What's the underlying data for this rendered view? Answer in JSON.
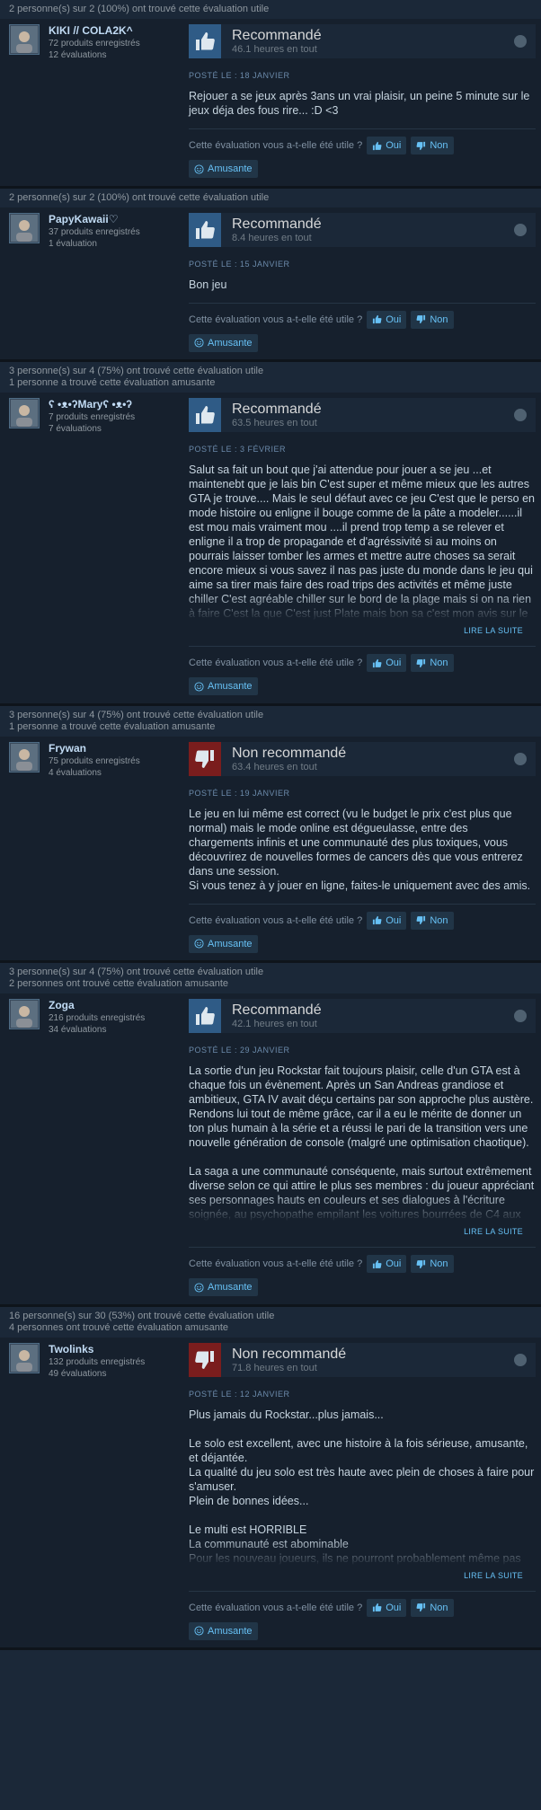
{
  "ui": {
    "helpful_question": "Cette évaluation vous a-t-elle été utile ?",
    "yes": "Oui",
    "no": "Non",
    "funny": "Amusante",
    "read_more": "LIRE LA SUITE"
  },
  "colors": {
    "recommended": "#2f5b86",
    "not_recommended": "#7a1d1d",
    "link": "#66c0f4"
  },
  "reviews": [
    {
      "helpful_line": "2 personne(s) sur 2 (100%) ont trouvé cette évaluation utile",
      "funny_line": "",
      "user": "KIKI // COLA2K^",
      "products": "72 produits enregistrés",
      "reviews_count": "12 évaluations",
      "recommended": true,
      "verdict": "Recommandé",
      "hours": "46.1 heures en tout",
      "posted": "POSTÉ LE : 18 JANVIER",
      "text": "Rejouer a se jeux après 3ans un vrai plaisir, un peine 5 minute sur le jeux déja des fous rire... :D <3",
      "read_more": false
    },
    {
      "helpful_line": "2 personne(s) sur 2 (100%) ont trouvé cette évaluation utile",
      "funny_line": "",
      "user": "PapyKawaii♡",
      "products": "37 produits enregistrés",
      "reviews_count": "1 évaluation",
      "recommended": true,
      "verdict": "Recommandé",
      "hours": "8.4 heures en tout",
      "posted": "POSTÉ LE : 15 JANVIER",
      "text": "Bon jeu",
      "read_more": false
    },
    {
      "helpful_line": "3 personne(s) sur 4 (75%) ont trouvé cette évaluation utile",
      "funny_line": "1 personne a trouvé cette évaluation amusante",
      "user": "ʕ •ᴥ•ʔMaryʕ •ᴥ•ʔ",
      "products": "7 produits enregistrés",
      "reviews_count": "7 évaluations",
      "recommended": true,
      "verdict": "Recommandé",
      "hours": "63.5 heures en tout",
      "posted": "POSTÉ LE : 3 FÉVRIER",
      "text": "Salut sa fait un bout que j'ai attendue pour jouer a se jeu ...et maintenebt que je lais bin C'est super et même mieux que les autres GTA je trouve.... Mais le seul défaut avec ce jeu C'est que le perso en mode histoire ou enligne il bouge comme de la pâte a modeler......il est mou mais vraiment mou ....il prend trop temp a se relever et enligne il a trop de propagande et d'agréssivité si au moins on pourrais laisser tomber les armes et mettre autre choses sa serait encore mieux si vous savez il nas pas juste du monde dans le jeu qui aime sa tirer mais faire des road trips des activités et même juste chiller C'est agréable chiller sur le bord de la plage mais si on na rien à faire C'est la que C'est just Plate mais bon sa c'est mon avis sur le jeu.... Mais apart sa C'est super.",
      "read_more": true
    },
    {
      "helpful_line": "3 personne(s) sur 4 (75%) ont trouvé cette évaluation utile",
      "funny_line": "1 personne a trouvé cette évaluation amusante",
      "user": "Frywan",
      "products": "75 produits enregistrés",
      "reviews_count": "4 évaluations",
      "recommended": false,
      "verdict": "Non recommandé",
      "hours": "63.4 heures en tout",
      "posted": "POSTÉ LE : 19 JANVIER",
      "text": "Le jeu en lui même est correct (vu le budget le prix c'est plus que normal) mais le mode online est dégueulasse, entre des chargements infinis et une communauté des plus toxiques, vous découvrirez de nouvelles formes de cancers dès que vous entrerez dans une session.\nSi vous tenez à y jouer en ligne, faites-le uniquement avec des amis.",
      "read_more": false
    },
    {
      "helpful_line": "3 personne(s) sur 4 (75%) ont trouvé cette évaluation utile",
      "funny_line": "2 personnes ont trouvé cette évaluation amusante",
      "user": "Zoga",
      "products": "216 produits enregistrés",
      "reviews_count": "34 évaluations",
      "recommended": true,
      "verdict": "Recommandé",
      "hours": "42.1 heures en tout",
      "posted": "POSTÉ LE : 29 JANVIER",
      "text": "La sortie d'un jeu Rockstar fait toujours plaisir, celle d'un GTA est à chaque fois un évènement. Après un San Andreas grandiose et ambitieux, GTA IV avait déçu certains par son approche plus austère. Rendons lui tout de même grâce, car il a eu le mérite de donner un ton plus humain à la série et a réussi le pari de la transition vers une nouvelle génération de console (malgré une optimisation chaotique).\n\nLa saga a une communauté conséquente, mais surtout extrêmement diverse selon ce qui attire le plus ses membres : du joueur appréciant ses personnages hauts en couleurs et ses dialogues à l'écriture soignée, au psychopathe empilant les voitures bourrées de C4 aux carrefours, en passant par le",
      "read_more": true
    },
    {
      "helpful_line": "16 personne(s) sur 30 (53%) ont trouvé cette évaluation utile",
      "funny_line": "4 personnes ont trouvé cette évaluation amusante",
      "user": "Twolinks",
      "products": "132 produits enregistrés",
      "reviews_count": "49 évaluations",
      "recommended": false,
      "verdict": "Non recommandé",
      "hours": "71.8 heures en tout",
      "posted": "POSTÉ LE : 12 JANVIER",
      "text": "Plus jamais du Rockstar...plus jamais...\n\nLe solo est excellent, avec une histoire à la fois sérieuse, amusante, et déjantée.\nLa qualité du jeu solo est très haute avec plein de choses à faire pour s'amuser.\nPlein de bonnes idées...\n\nLe multi est HORRIBLE\nLa communauté est abominable\nPour les nouveau joueurs, ils ne pourront probablement même pas terminer les premiers braquages faute de joueurs disponibles. (ce qui est mon cas)",
      "read_more": true
    }
  ]
}
